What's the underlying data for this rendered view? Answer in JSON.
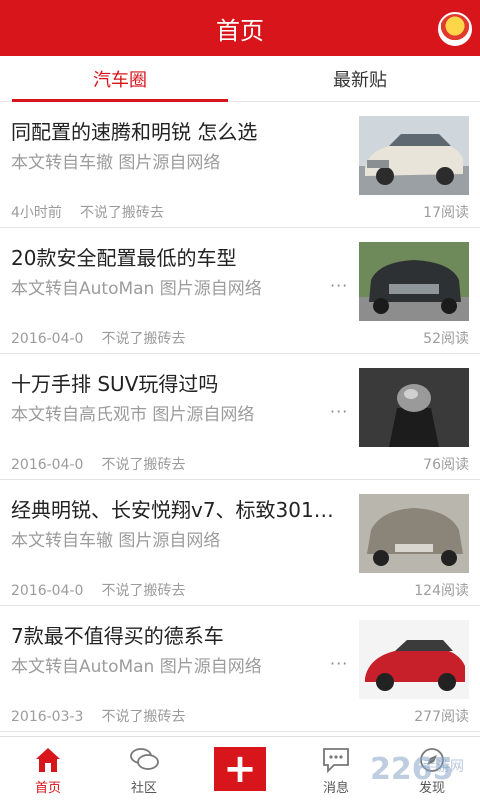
{
  "header": {
    "title": "首页"
  },
  "tabs": [
    {
      "label": "汽车圈",
      "active": true
    },
    {
      "label": "最新贴",
      "active": false
    }
  ],
  "posts": [
    {
      "title": "同配置的速腾和明锐 怎么选",
      "subtitle": "本文转自车撤 图片源自网络",
      "show_dots": false,
      "time": "4小时前",
      "author": "不说了搬砖去",
      "reads": "17阅读"
    },
    {
      "title": "20款安全配置最低的车型",
      "subtitle": "本文转自AutoMan 图片源自网络",
      "show_dots": true,
      "time": "2016-04-0",
      "author": "不说了搬砖去",
      "reads": "52阅读"
    },
    {
      "title": "十万手排 SUV玩得过吗",
      "subtitle": "本文转自高氏观市 图片源自网络",
      "show_dots": true,
      "time": "2016-04-0",
      "author": "不说了搬砖去",
      "reads": "76阅读"
    },
    {
      "title": "经典明锐、长安悦翔v7、标致301…",
      "subtitle": "本文转自车辙 图片源自网络",
      "show_dots": false,
      "time": "2016-04-0",
      "author": "不说了搬砖去",
      "reads": "124阅读"
    },
    {
      "title": "7款最不值得买的德系车",
      "subtitle": "本文转自AutoMan 图片源自网络",
      "show_dots": true,
      "time": "2016-03-3",
      "author": "不说了搬砖去",
      "reads": "277阅读"
    }
  ],
  "dots": "···",
  "bottom_nav": [
    {
      "label": "首页",
      "icon": "home-icon",
      "active": true
    },
    {
      "label": "社区",
      "icon": "chat-icon",
      "active": false
    },
    {
      "label": "",
      "icon": "plus-icon",
      "active": false
    },
    {
      "label": "消息",
      "icon": "message-icon",
      "active": false
    },
    {
      "label": "发现",
      "icon": "compass-icon",
      "active": false
    }
  ],
  "watermark": {
    "text": "2265",
    "small": "手游网"
  },
  "colors": {
    "accent": "#d7151b",
    "text": "#222222",
    "muted": "#9c9c9c"
  }
}
